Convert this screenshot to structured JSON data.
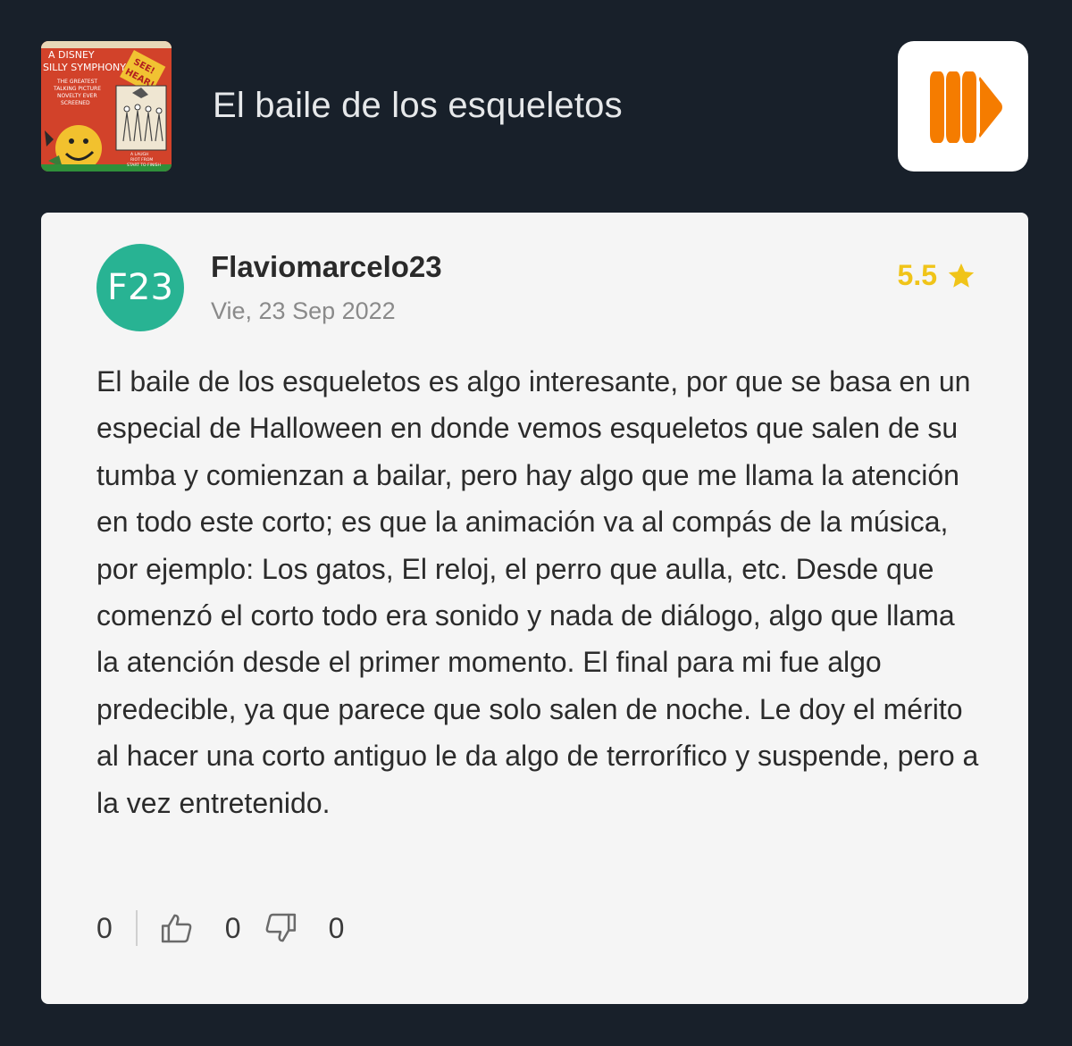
{
  "header": {
    "movie_title": "El baile de los esqueletos",
    "poster": {
      "lines": [
        "A DISNEY",
        "SILLY SYMPHONY",
        "THE GREATEST",
        "TALKING PICTURE",
        "NOVELTY EVER",
        "SCREENED",
        "SEE!",
        "HEAR!",
        "A LAUGH",
        "RIOT FROM",
        "START TO FINISH"
      ]
    },
    "app_logo_icon": "orange-play-bars-icon",
    "app_logo_color": "#f57c00"
  },
  "review": {
    "avatar_initials": "F23",
    "avatar_color": "#28b393",
    "username": "Flaviomarcelo23",
    "date": "Vie, 23 Sep 2022",
    "rating": "5.5",
    "rating_color": "#f0c419",
    "rating_icon": "star-icon",
    "text": "El baile de los esqueletos es algo interesante, por que se basa en un especial de Halloween en donde vemos esqueletos que salen de su tumba y comienzan a bailar, pero hay algo que me llama la atención en todo este corto; es que la animación va al compás de la música, por ejemplo: Los gatos, El reloj, el perro que aulla, etc. Desde que comenzó el corto todo era sonido y nada de diálogo, algo que llama la atención desde el primer momento. El final para mi fue algo predecible, ya que parece que solo salen de noche. Le doy el mérito al hacer una corto antiguo le da algo de terrorífico y suspende, pero a la vez entretenido.",
    "actions": {
      "comments_count": "0",
      "likes_count": "0",
      "dislikes_count": "0",
      "like_icon": "thumbs-up-icon",
      "dislike_icon": "thumbs-down-icon"
    }
  }
}
